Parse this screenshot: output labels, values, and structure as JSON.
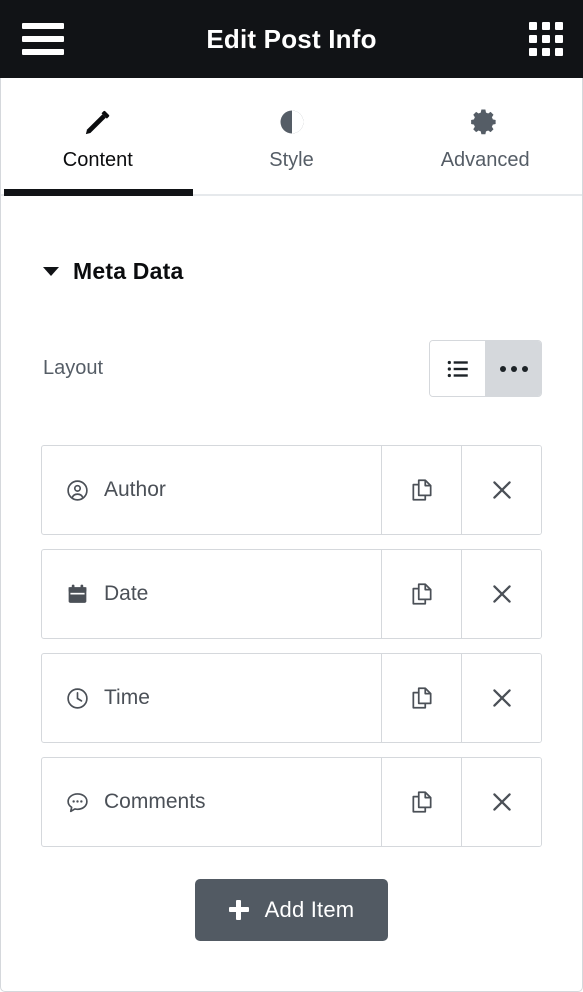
{
  "topbar": {
    "menu_icon": "hamburger-menu-icon",
    "title": "Edit Post Info",
    "apps_icon": "apps-grid-icon"
  },
  "tabs": [
    {
      "label": "Content",
      "icon": "pencil-icon",
      "active": true
    },
    {
      "label": "Style",
      "icon": "contrast-icon",
      "active": false
    },
    {
      "label": "Advanced",
      "icon": "gear-icon",
      "active": false
    }
  ],
  "section": {
    "title": "Meta Data",
    "collapse_icon": "caret-down-icon",
    "expanded": true
  },
  "layout_control": {
    "label": "Layout",
    "options": [
      {
        "name": "stacked",
        "icon": "list-icon",
        "selected": false
      },
      {
        "name": "inline",
        "icon": "ellipsis-icon",
        "selected": true
      }
    ]
  },
  "repeater": {
    "items": [
      {
        "label": "Author",
        "icon": "user-circle-icon",
        "duplicate_icon": "copy-icon",
        "remove_icon": "close-icon"
      },
      {
        "label": "Date",
        "icon": "calendar-icon",
        "duplicate_icon": "copy-icon",
        "remove_icon": "close-icon"
      },
      {
        "label": "Time",
        "icon": "clock-icon",
        "duplicate_icon": "copy-icon",
        "remove_icon": "close-icon"
      },
      {
        "label": "Comments",
        "icon": "comment-icon",
        "duplicate_icon": "copy-icon",
        "remove_icon": "close-icon"
      }
    ],
    "add_label": "Add Item",
    "add_icon": "plus-icon"
  },
  "colors": {
    "topbar_bg": "#111316",
    "accent_dark": "#111316",
    "slate": "#555d66",
    "label": "#4b5057",
    "border": "#d5d8dc",
    "selected_bg": "#d5d8dc",
    "button_bg": "#525a63"
  }
}
